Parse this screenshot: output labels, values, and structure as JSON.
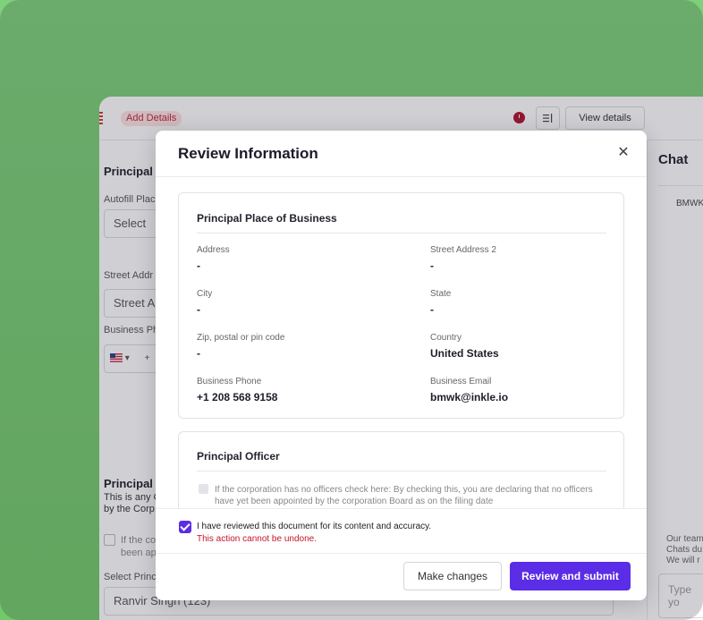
{
  "topbar": {
    "badge": "Add Details",
    "view_details": "View details"
  },
  "background_form": {
    "section1_title": "Principal P",
    "autofill_label": "Autofill Plac",
    "autofill_value": "Select",
    "street_label": "Street Addr",
    "street_placeholder": "Street A",
    "phone_label": "Business Ph",
    "phone_country": "▾",
    "phone_plus": "+",
    "section2_title": "Principal O",
    "section2_desc_1": "This is any O",
    "section2_desc_2": "by the Corp",
    "check_text_1": "If the co",
    "check_text_2": "been ap",
    "select_label": "Select Princ",
    "select_value": "Ranvir Singh (123)"
  },
  "chat": {
    "title": "Chat",
    "name": "BMWK",
    "info_1": "Our team",
    "info_2": "Chats du",
    "info_3": "We will r",
    "input_placeholder": "Type yo"
  },
  "modal": {
    "title": "Review Information",
    "principal_place": {
      "title": "Principal Place of Business",
      "fields": [
        {
          "label": "Address",
          "value": "-"
        },
        {
          "label": "Street Address 2",
          "value": "-"
        },
        {
          "label": "City",
          "value": "-"
        },
        {
          "label": "State",
          "value": "-"
        },
        {
          "label": "Zip, postal or pin code",
          "value": "-"
        },
        {
          "label": "Country",
          "value": "United States"
        },
        {
          "label": "Business Phone",
          "value": "+1 208 568 9158"
        },
        {
          "label": "Business Email",
          "value": "bmwk@inkle.io"
        }
      ]
    },
    "principal_officer": {
      "title": "Principal Officer",
      "checkbox_text": "If the corporation has no officers check here: By checking this, you are declaring that no officers have yet been appointed by the corporation Board as on the filing date"
    },
    "confirm": {
      "text": "I have reviewed this document for its content and accuracy.",
      "warning": "This action cannot be undone."
    },
    "buttons": {
      "secondary": "Make changes",
      "primary": "Review and submit"
    }
  },
  "colors": {
    "accent": "#5b2de6",
    "warning": "#c4152d",
    "background": "#74cb6d"
  }
}
